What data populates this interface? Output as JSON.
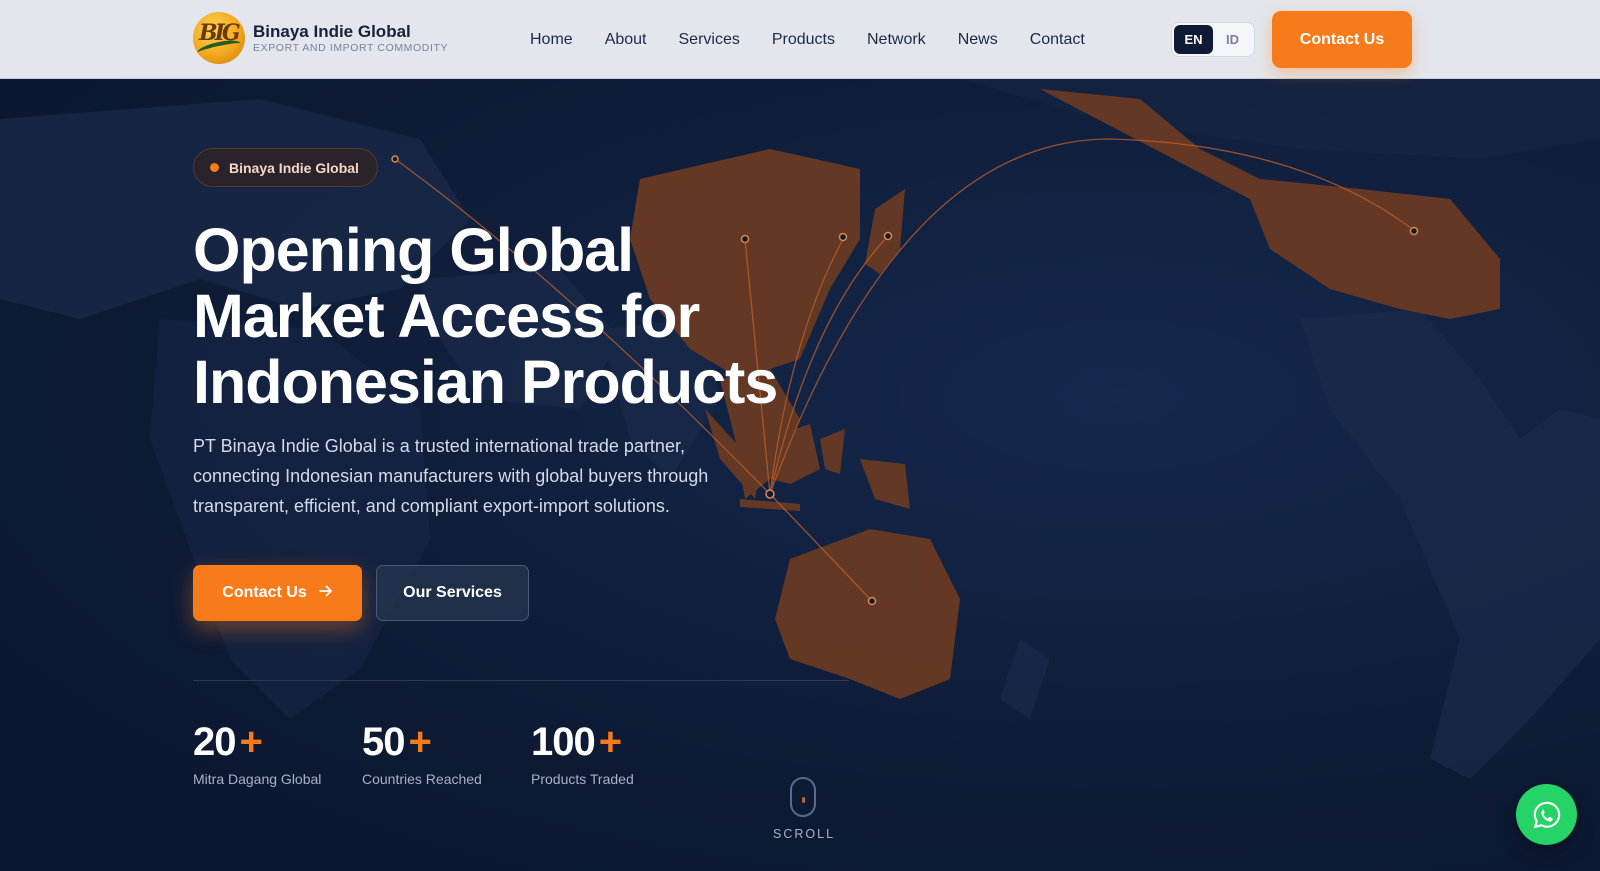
{
  "header": {
    "brand_name": "Binaya Indie Global",
    "brand_tagline": "EXPORT AND IMPORT COMMODITY",
    "logo_letters": "BIG",
    "nav": [
      "Home",
      "About",
      "Services",
      "Products",
      "Network",
      "News",
      "Contact"
    ],
    "lang": {
      "active": "EN",
      "inactive": "ID"
    },
    "cta_label": "Contact Us"
  },
  "hero": {
    "eyebrow": "Binaya Indie Global",
    "title_lines": [
      "Opening Global",
      "Market Access for",
      "Indonesian Products"
    ],
    "description": "PT Binaya Indie Global is a trusted international trade partner, connecting Indonesian manufacturers with global buyers through transparent, efficient, and compliant export-import solutions.",
    "primary_cta": "Contact Us",
    "secondary_cta": "Our Services",
    "stats": [
      {
        "value": "20",
        "suffix": "+",
        "label": "Mitra Dagang Global"
      },
      {
        "value": "50",
        "suffix": "+",
        "label": "Countries Reached"
      },
      {
        "value": "100",
        "suffix": "+",
        "label": "Products Traded"
      }
    ],
    "scroll_label": "SCROLL"
  },
  "colors": {
    "accent": "#f77a1b",
    "navy": "#0e1b35",
    "highlight_land": "#6b3b22",
    "land": "#1c2c4c",
    "whatsapp": "#25d366"
  },
  "icons": {
    "primary_cta": "arrow-right-icon",
    "scroll": "mouse-icon",
    "floating": "whatsapp-icon"
  }
}
